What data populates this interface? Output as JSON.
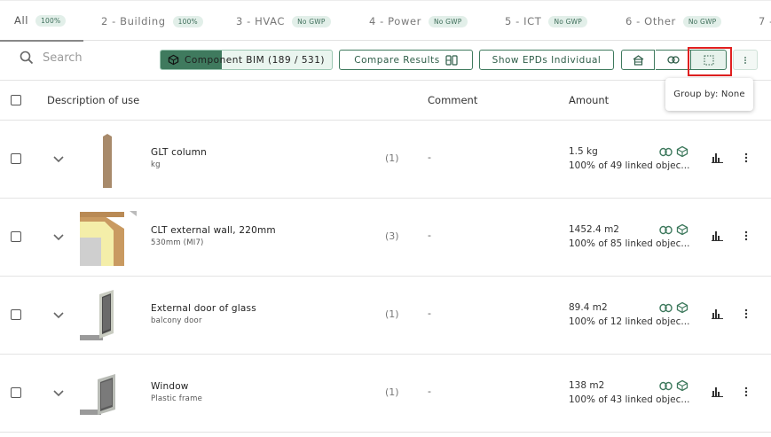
{
  "tabs": [
    {
      "label": "All",
      "badge": "100%",
      "active": true
    },
    {
      "label": "2 - Building",
      "badge": "100%"
    },
    {
      "label": "3 - HVAC",
      "badge": "No GWP"
    },
    {
      "label": "4 - Power",
      "badge": "No GWP"
    },
    {
      "label": "5 - ICT",
      "badge": "No GWP"
    },
    {
      "label": "6 - Other",
      "badge": "No GWP"
    },
    {
      "label": "7 -",
      "badge": ""
    }
  ],
  "toolbar": {
    "search_placeholder": "Search",
    "bim_label": "Component BIM (189 / 531)",
    "bim_progress": 0.356,
    "compare_label": "Compare Results",
    "epd_label": "Show EPDs Individual",
    "icons": [
      "building-icon",
      "link-icon",
      "group-icon",
      "more-vertical-icon"
    ]
  },
  "tooltip": {
    "text": "Group by: None"
  },
  "table": {
    "headers": {
      "description": "Description of use",
      "comment": "Comment",
      "amount": "Amount"
    },
    "rows": [
      {
        "name": "GLT column",
        "sub": "kg",
        "count": "(1)",
        "comment": "-",
        "amount": "1.5 kg",
        "linked": "100% of 49 linked objec..."
      },
      {
        "name": "CLT external wall, 220mm",
        "sub": "530mm (MI7)",
        "count": "(3)",
        "comment": "-",
        "amount": "1452.4 m2",
        "linked": "100% of 85 linked objec..."
      },
      {
        "name": "External door of glass",
        "sub": "balcony door",
        "count": "(1)",
        "comment": "-",
        "amount": "89.4 m2",
        "linked": "100% of 12 linked objec..."
      },
      {
        "name": "Window",
        "sub": "Plastic frame",
        "count": "(1)",
        "comment": "-",
        "amount": "138 m2",
        "linked": "100% of 43 linked objec..."
      }
    ]
  },
  "colors": {
    "accent": "#3f7a5e",
    "badge_bg": "#e2efe9",
    "highlight": "#e02020"
  }
}
